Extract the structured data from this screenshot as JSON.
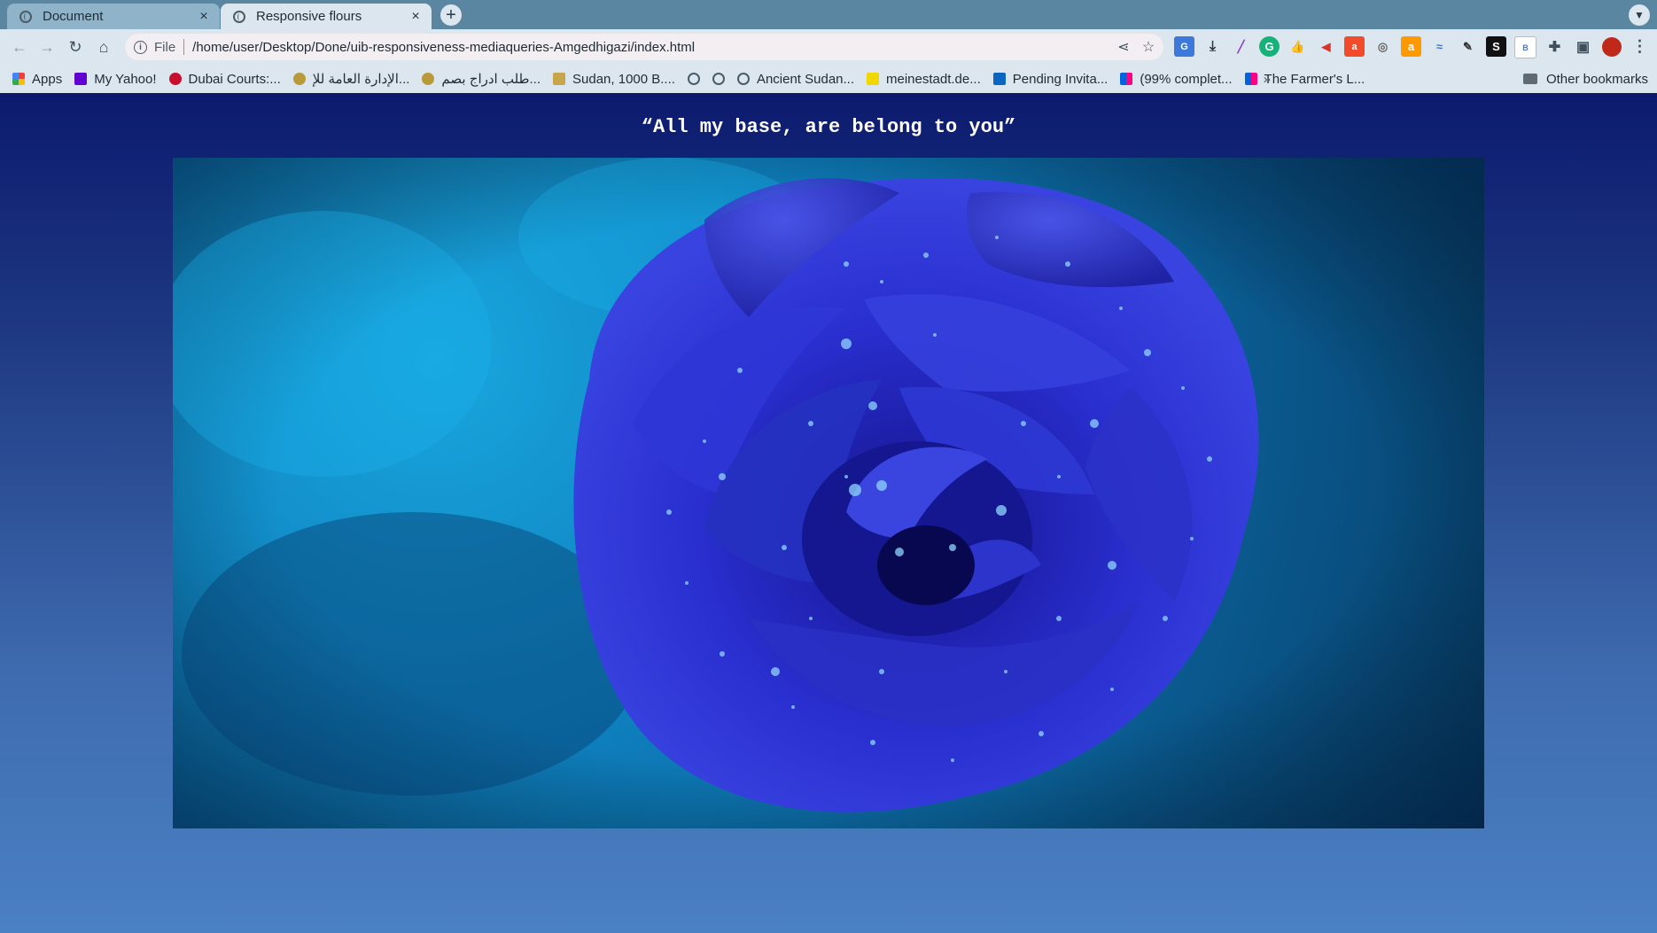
{
  "tabs": [
    {
      "label": "Document",
      "active": false
    },
    {
      "label": "Responsive flours",
      "active": true
    }
  ],
  "tab_close_glyph": "×",
  "newtab_glyph": "+",
  "toolbar": {
    "scheme_label": "File",
    "url": "/home/user/Desktop/Done/uib-responsiveness-mediaqueries-Amgedhigazi/index.html"
  },
  "bookmarks": {
    "items": [
      {
        "label": "Apps",
        "icon": "apps-grid-icon"
      },
      {
        "label": "My Yahoo!",
        "icon": "yahoo-icon"
      },
      {
        "label": "Dubai Courts:...",
        "icon": "dubai-courts-icon"
      },
      {
        "label": "الإدارة العامة للإ...",
        "icon": "emblem-icon"
      },
      {
        "label": "طلب ادراج بصم...",
        "icon": "emblem-icon"
      },
      {
        "label": "Sudan, 1000 B....",
        "icon": "folder-yellow-icon"
      },
      {
        "label": "",
        "icon": "globe-icon"
      },
      {
        "label": "",
        "icon": "globe-icon"
      },
      {
        "label": "Ancient Sudan...",
        "icon": "globe-icon"
      },
      {
        "label": "meinestadt.de...",
        "icon": "meinestadt-icon"
      },
      {
        "label": "Pending Invita...",
        "icon": "linkedin-icon"
      },
      {
        "label": "(99% complet...",
        "icon": "flickr-icon"
      },
      {
        "label": "The Farmer's L...",
        "icon": "flickr-icon"
      }
    ],
    "more_glyph": "»",
    "other_label": "Other bookmarks"
  },
  "page": {
    "quote": "“All my base, are belong to you”",
    "image_subject": "blue rose with water droplets"
  },
  "colors": {
    "page_gradient_top": "#0c1a6e",
    "page_gradient_bottom": "#4a80c4",
    "rose": "#2a2fd0"
  }
}
